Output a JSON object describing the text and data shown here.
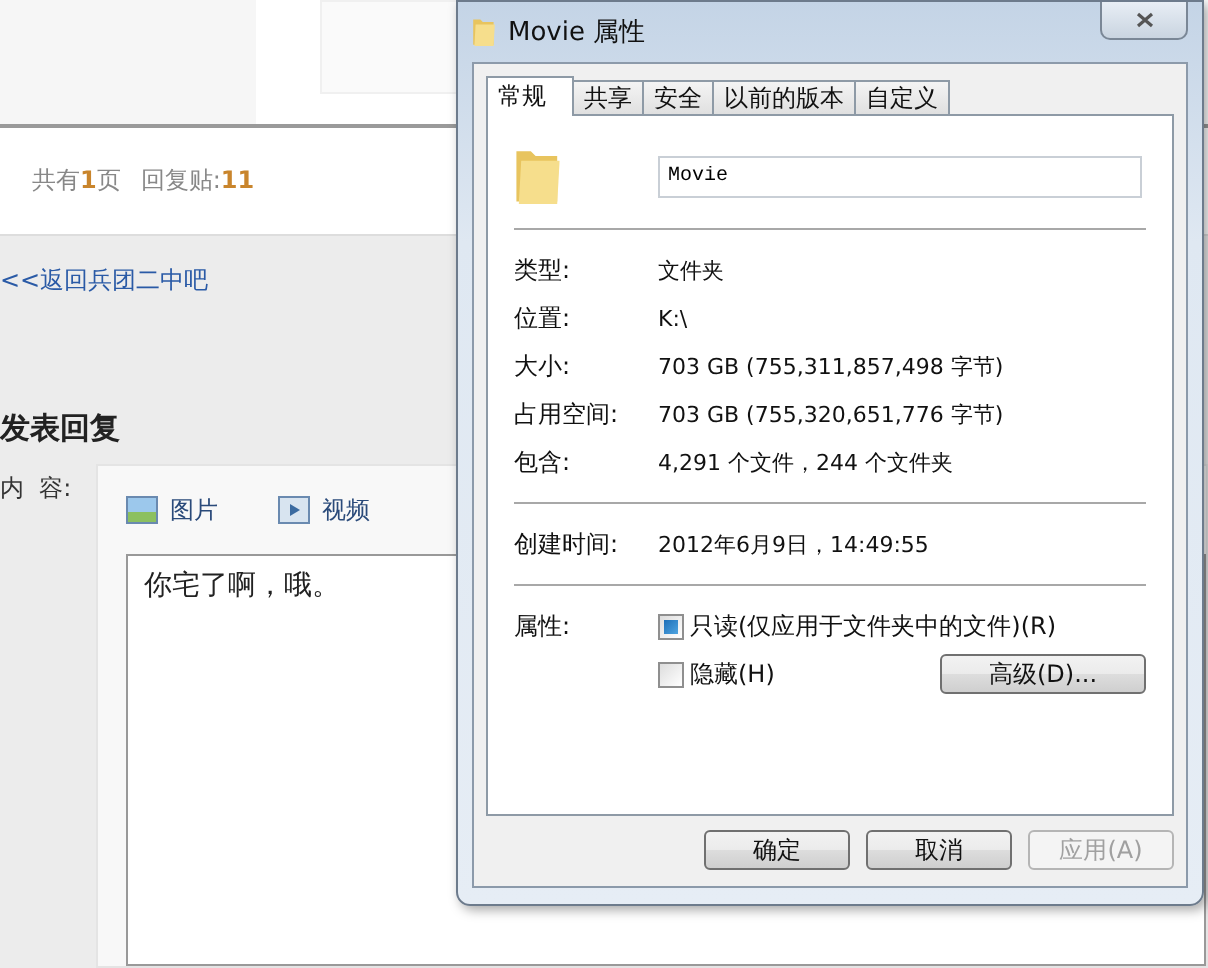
{
  "page": {
    "stats": [
      {
        "label": "共有",
        "value": "1",
        "suffix": "页"
      },
      {
        "label": "回复贴:",
        "value": "11"
      }
    ],
    "back_link": "<<返回兵团二中吧",
    "reply_heading": "发表回复",
    "content_label": "内  容:",
    "editor_tools": [
      {
        "kind": "image",
        "label": "图片"
      },
      {
        "kind": "video",
        "label": "视频"
      }
    ],
    "editor_text": "你宅了啊，哦。"
  },
  "dialog": {
    "title": "Movie 属性",
    "tabs": [
      {
        "label": "常规",
        "selected": true
      },
      {
        "label": "共享",
        "selected": false
      },
      {
        "label": "安全",
        "selected": false
      },
      {
        "label": "以前的版本",
        "selected": false
      },
      {
        "label": "自定义",
        "selected": false
      }
    ],
    "name_value": "Movie",
    "sections": [
      [
        {
          "label": "类型:",
          "value": "文件夹"
        },
        {
          "label": "位置:",
          "value": "K:\\"
        },
        {
          "label": "大小:",
          "value": "703 GB (755,311,857,498 字节)"
        },
        {
          "label": "占用空间:",
          "value": "703 GB (755,320,651,776 字节)"
        },
        {
          "label": "包含:",
          "value": "4,291 个文件，244 个文件夹"
        }
      ],
      [
        {
          "label": "创建时间:",
          "value": "2012年6月9日，14:49:55"
        }
      ]
    ],
    "attributes_label": "属性:",
    "attributes": [
      {
        "label": "只读(仅应用于文件夹中的文件)(R)",
        "checked": true
      },
      {
        "label": "隐藏(H)",
        "checked": false
      }
    ],
    "advanced_button": "高级(D)...",
    "buttons": [
      {
        "label": "确定",
        "disabled": false
      },
      {
        "label": "取消",
        "disabled": false
      },
      {
        "label": "应用(A)",
        "disabled": true
      }
    ]
  }
}
